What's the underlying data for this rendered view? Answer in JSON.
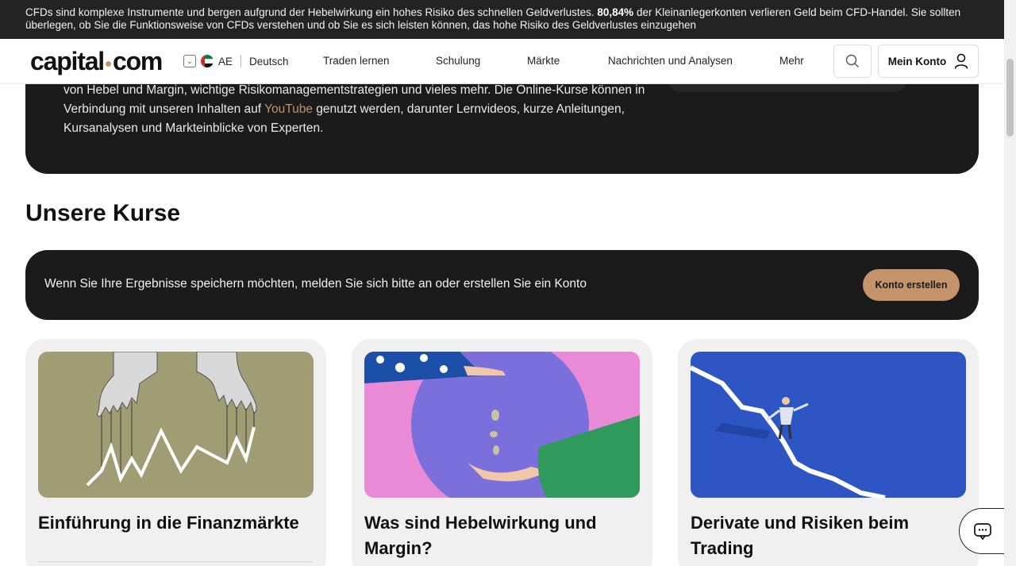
{
  "risk_banner": {
    "text_before": "CFDs sind komplexe Instrumente und bergen aufgrund der Hebelwirkung ein hohes Risiko des schnellen Geldverlustes. ",
    "percent": "80,84%",
    "text_after": " der Kleinanlegerkonten verlieren Geld beim CFD-Handel. Sie sollten überlegen, ob Sie die Funktionsweise von CFDs verstehen und ob Sie es sich leisten können, das hohe Risiko des Geldverlustes einzugehen"
  },
  "header": {
    "logo_left": "capital",
    "logo_right": "com",
    "region_code": "AE",
    "language": "Deutsch",
    "nav": [
      "Traden lernen",
      "Schulung",
      "Märkte",
      "Nachrichten und Analysen",
      "Mehr"
    ],
    "account_label": "Mein Konto"
  },
  "hero": {
    "line_start": "von Hebel und Margin, wichtige Risikomanagementstrategien und vieles mehr. Die Online-Kurse können in Verbindung mit unseren Inhalten auf ",
    "link": "YouTube",
    "line_end": " genutzt werden, darunter Lernvideos, kurze Anleitungen, Kursanalysen und Markteinblicke von Experten."
  },
  "section_title": "Unsere Kurse",
  "login_bar": {
    "text": "Wenn Sie Ihre Ergebnisse speichern möchten, melden Sie sich bitte an oder erstellen Sie ein Konto",
    "button": "Konto erstellen"
  },
  "courses": [
    {
      "title": "Einführung in die Finanzmärkte",
      "image_bg": "#a09d75"
    },
    {
      "title": "Was sind Hebelwirkung und Margin?",
      "image_bg": "#e98ad6"
    },
    {
      "title": "Derivate und Risiken beim Trading",
      "image_bg": "#2d55c4"
    }
  ],
  "colors": {
    "accent": "#c4936a",
    "dark": "#1b1b1b"
  }
}
